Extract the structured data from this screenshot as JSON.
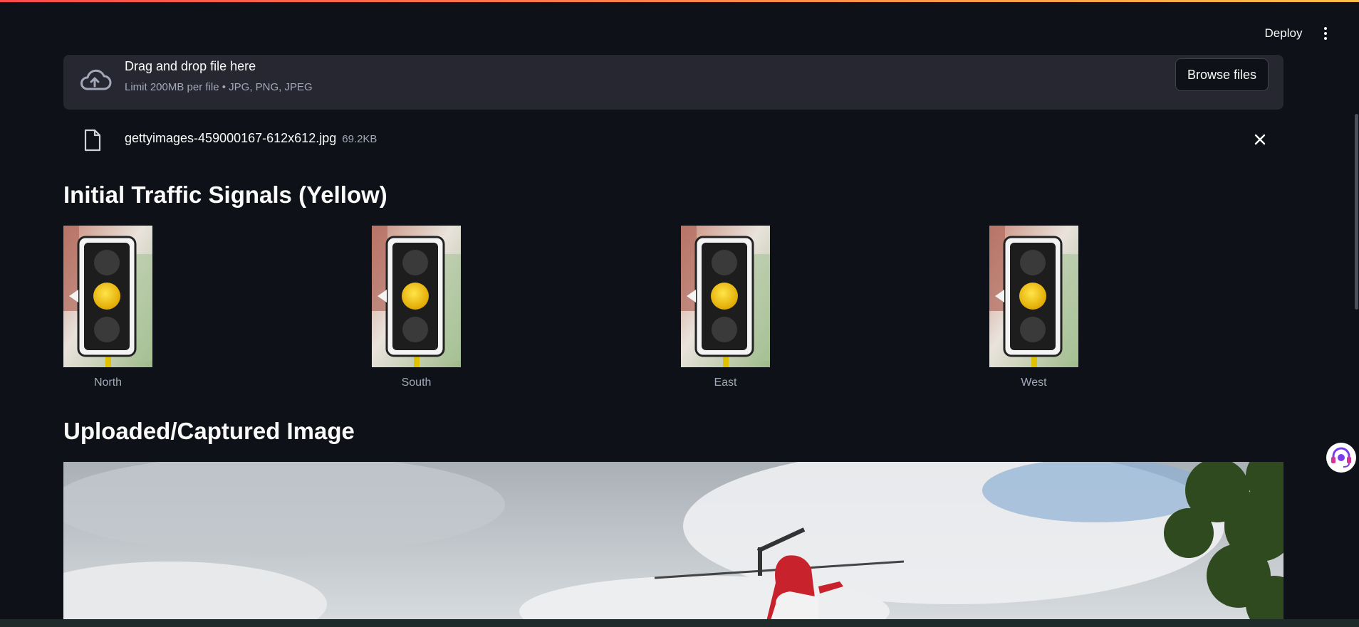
{
  "header": {
    "deploy_label": "Deploy",
    "menu_icon": "more-vertical-icon"
  },
  "uploader": {
    "title": "Drag and drop file here",
    "subtitle": "Limit 200MB per file • JPG, PNG, JPEG",
    "browse_label": "Browse files",
    "icon": "cloud-upload-icon"
  },
  "file": {
    "name": "gettyimages-459000167-612x612.jpg",
    "size": "69.2KB",
    "icon": "file-icon",
    "remove_icon": "close-icon"
  },
  "signals": {
    "heading": "Initial Traffic Signals (Yellow)",
    "items": [
      {
        "label": "North",
        "state": "yellow"
      },
      {
        "label": "South",
        "state": "yellow"
      },
      {
        "label": "East",
        "state": "yellow"
      },
      {
        "label": "West",
        "state": "yellow"
      }
    ]
  },
  "image_section": {
    "heading": "Uploaded/Captured Image"
  },
  "colors": {
    "background": "#0e1117",
    "panel": "#262730",
    "signal_yellow": "#f5c000",
    "text_muted": "#a3a8b8"
  }
}
